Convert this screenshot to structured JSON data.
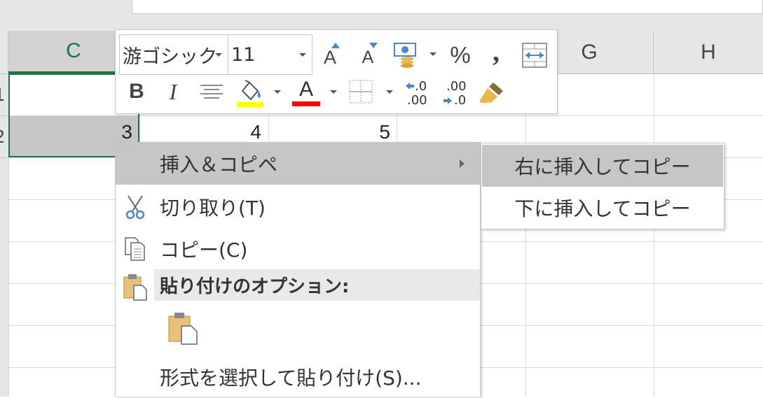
{
  "sheet": {
    "columns": [
      "C",
      "",
      "",
      "G",
      "H"
    ],
    "row_numbers": [
      "1",
      "2"
    ],
    "cells": {
      "c2": "3",
      "d2": "4",
      "e2": "5"
    }
  },
  "mini_toolbar": {
    "font_name": "游ゴシック",
    "font_size": "11",
    "bold_label": "B",
    "italic_label": "I",
    "grow_font_label": "A",
    "shrink_font_label": "A",
    "percent_label": "%",
    "comma_label": ",",
    "increase_decimal_top": ".0",
    "increase_decimal_bottom": ".00",
    "decrease_decimal_top": ".00",
    "decrease_decimal_bottom": ".0",
    "font_color_label": "A",
    "fill_color": "#ffff00",
    "font_color": "#ff0000",
    "icons": [
      "increase-font-size-icon",
      "decrease-font-size-icon",
      "accounting-format-icon",
      "percent-style-icon",
      "comma-style-icon",
      "merge-center-icon",
      "center-align-icon",
      "fill-color-icon",
      "font-color-icon",
      "borders-icon",
      "increase-decimal-icon",
      "decrease-decimal-icon",
      "format-painter-icon"
    ]
  },
  "context_menu": {
    "insert_copy": "挿入＆コピペ",
    "cut": "切り取り(T)",
    "copy": "コピー(C)",
    "paste_options_header": "貼り付けのオプション:",
    "paste_special": "形式を選択して貼り付け(S)..."
  },
  "submenu": {
    "insert_right": "右に挿入してコピー",
    "insert_down": "下に挿入してコピー"
  },
  "colors": {
    "selection_accent": "#217346",
    "highlight": "#c6c6c6"
  }
}
